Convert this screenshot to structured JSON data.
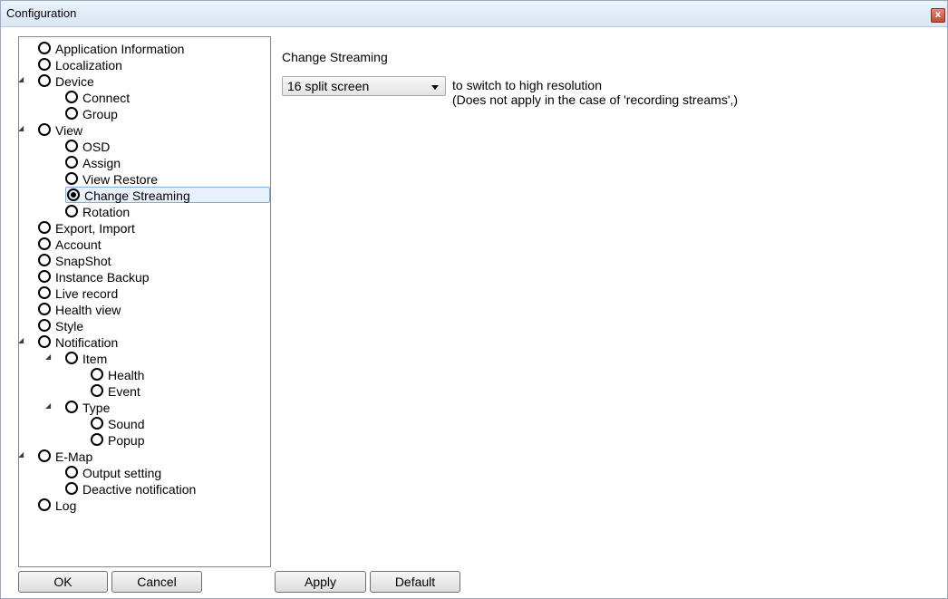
{
  "window": {
    "title": "Configuration",
    "close_glyph": "x"
  },
  "tree": {
    "items": [
      {
        "label": "Application Information",
        "checked": false
      },
      {
        "label": "Localization",
        "checked": false
      },
      {
        "label": "Device",
        "checked": false,
        "expander": "◢"
      },
      {
        "label": "Connect",
        "checked": false
      },
      {
        "label": "Group",
        "checked": false
      },
      {
        "label": "View",
        "checked": false,
        "expander": "◢"
      },
      {
        "label": "OSD",
        "checked": false
      },
      {
        "label": "Assign",
        "checked": false
      },
      {
        "label": "View Restore",
        "checked": false
      },
      {
        "label": "Change Streaming",
        "checked": true,
        "selected": true
      },
      {
        "label": "Rotation",
        "checked": false
      },
      {
        "label": "Export, Import",
        "checked": false
      },
      {
        "label": "Account",
        "checked": false
      },
      {
        "label": "SnapShot",
        "checked": false
      },
      {
        "label": "Instance Backup",
        "checked": false
      },
      {
        "label": "Live record",
        "checked": false
      },
      {
        "label": "Health view",
        "checked": false
      },
      {
        "label": "Style",
        "checked": false
      },
      {
        "label": "Notification",
        "checked": false,
        "expander": "◢"
      },
      {
        "label": "Item",
        "checked": false,
        "expander": "◢"
      },
      {
        "label": "Health",
        "checked": false
      },
      {
        "label": "Event",
        "checked": false
      },
      {
        "label": "Type",
        "checked": false,
        "expander": "◢"
      },
      {
        "label": "Sound",
        "checked": false
      },
      {
        "label": "Popup",
        "checked": false
      },
      {
        "label": "E-Map",
        "checked": false,
        "expander": "◢"
      },
      {
        "label": "Output setting",
        "checked": false
      },
      {
        "label": "Deactive notification",
        "checked": false
      },
      {
        "label": "Log",
        "checked": false
      }
    ]
  },
  "panel": {
    "section_title": "Change Streaming",
    "combo_value": "16 split screen",
    "desc_line1": "to switch to high resolution",
    "desc_line2": "(Does not apply in the case of 'recording streams',)"
  },
  "buttons": {
    "ok": "OK",
    "cancel": "Cancel",
    "apply": "Apply",
    "default": "Default"
  }
}
